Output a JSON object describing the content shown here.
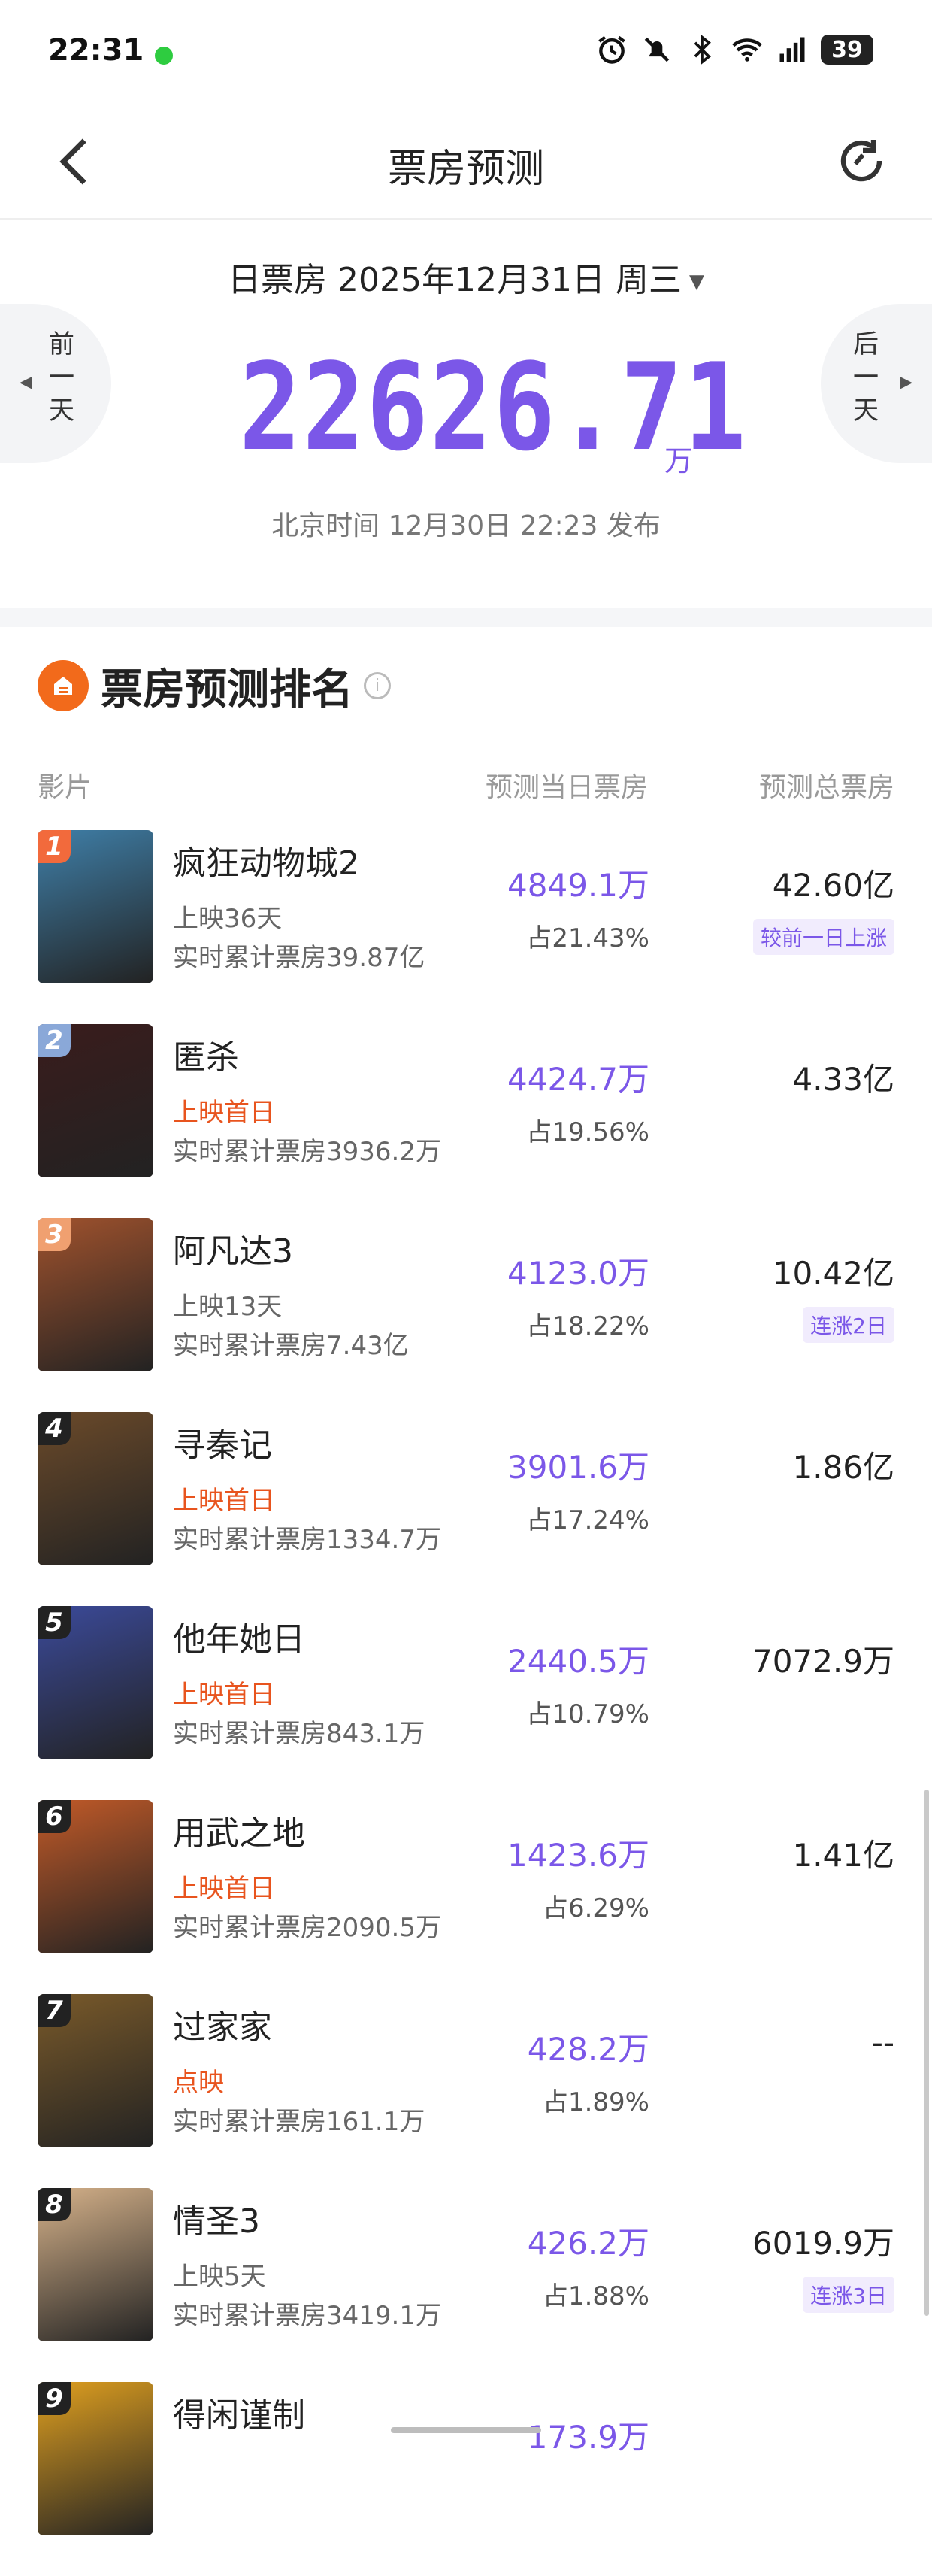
{
  "status_bar": {
    "time": "22:31",
    "battery": "39"
  },
  "nav": {
    "title": "票房预测"
  },
  "hero": {
    "date_label": "日票房 2025年12月31日 周三",
    "prev_label": "前一天",
    "next_label": "后一天",
    "amount": "22626.71",
    "unit": "万",
    "published": "北京时间 12月30日 22:23 发布"
  },
  "ranking": {
    "title": "票房预测排名",
    "col_film": "影片",
    "col_pred": "预测当日票房",
    "col_total": "预测总票房",
    "rows": [
      {
        "rank": "1",
        "name": "疯狂动物城2",
        "status": "上映36天",
        "cum": "实时累计票房39.87亿",
        "pred": "4849.1万",
        "share": "占21.43%",
        "total": "42.60亿",
        "tag": "较前一日上涨",
        "badge_color": "#f26a3c",
        "poster_color": "#3f7fa8"
      },
      {
        "rank": "2",
        "name": "匿杀",
        "status": "上映首日",
        "cum": "实时累计票房3936.2万",
        "pred": "4424.7万",
        "share": "占19.56%",
        "total": "4.33亿",
        "tag": "",
        "badge_color": "#8aa8d8",
        "poster_color": "#3a1c1c"
      },
      {
        "rank": "3",
        "name": "阿凡达3",
        "status": "上映13天",
        "cum": "实时累计票房7.43亿",
        "pred": "4123.0万",
        "share": "占18.22%",
        "total": "10.42亿",
        "tag": "连涨2日",
        "badge_color": "#f0a070",
        "poster_color": "#a0522d"
      },
      {
        "rank": "4",
        "name": "寻秦记",
        "status": "上映首日",
        "cum": "实时累计票房1334.7万",
        "pred": "3901.6万",
        "share": "占17.24%",
        "total": "1.86亿",
        "tag": "",
        "badge_color": "#222222",
        "poster_color": "#6b4a2a"
      },
      {
        "rank": "5",
        "name": "他年她日",
        "status": "上映首日",
        "cum": "实时累计票房843.1万",
        "pred": "2440.5万",
        "share": "占10.79%",
        "total": "7072.9万",
        "tag": "",
        "badge_color": "#222222",
        "poster_color": "#3b4a9a"
      },
      {
        "rank": "6",
        "name": "用武之地",
        "status": "上映首日",
        "cum": "实时累计票房2090.5万",
        "pred": "1423.6万",
        "share": "占6.29%",
        "total": "1.41亿",
        "tag": "",
        "badge_color": "#222222",
        "poster_color": "#c25a28"
      },
      {
        "rank": "7",
        "name": "过家家",
        "status": "点映",
        "cum": "实时累计票房161.1万",
        "pred": "428.2万",
        "share": "占1.89%",
        "total": "--",
        "tag": "",
        "badge_color": "#222222",
        "poster_color": "#7a5a2a"
      },
      {
        "rank": "8",
        "name": "情圣3",
        "status": "上映5天",
        "cum": "实时累计票房3419.1万",
        "pred": "426.2万",
        "share": "占1.88%",
        "total": "6019.9万",
        "tag": "连涨3日",
        "badge_color": "#222222",
        "poster_color": "#d6b28a"
      },
      {
        "rank": "9",
        "name": "得闲谨制",
        "status": "",
        "cum": "",
        "pred": "173.9万",
        "share": "",
        "total": "",
        "tag": "",
        "badge_color": "#222222",
        "poster_color": "#e0a020"
      }
    ]
  }
}
